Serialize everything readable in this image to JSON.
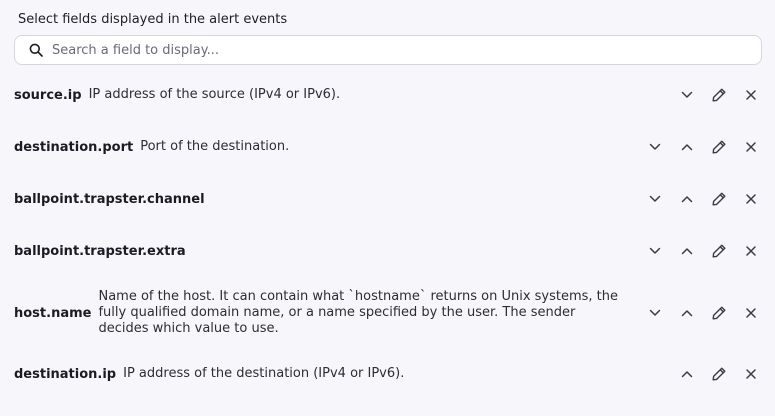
{
  "title": "Select fields displayed in the alert events",
  "search": {
    "placeholder": "Search a field to display..."
  },
  "icons": {
    "search": "search-icon",
    "down": "chevron-down-icon",
    "up": "chevron-up-icon",
    "edit": "pencil-icon",
    "remove": "close-icon"
  },
  "fields": [
    {
      "name": "source.ip",
      "description": "IP address of the source (IPv4 or IPv6).",
      "can_move_up": false,
      "can_move_down": true
    },
    {
      "name": "destination.port",
      "description": "Port of the destination.",
      "can_move_up": true,
      "can_move_down": true
    },
    {
      "name": "ballpoint.trapster.channel",
      "description": "",
      "can_move_up": true,
      "can_move_down": true
    },
    {
      "name": "ballpoint.trapster.extra",
      "description": "",
      "can_move_up": true,
      "can_move_down": true
    },
    {
      "name": "host.name",
      "description": "Name of the host. It can contain what `hostname` returns on Unix systems, the fully qualified domain name, or a name specified by the user. The sender decides which value to use.",
      "can_move_up": true,
      "can_move_down": true
    },
    {
      "name": "destination.ip",
      "description": "IP address of the destination (IPv4 or IPv6).",
      "can_move_up": true,
      "can_move_down": false
    }
  ]
}
